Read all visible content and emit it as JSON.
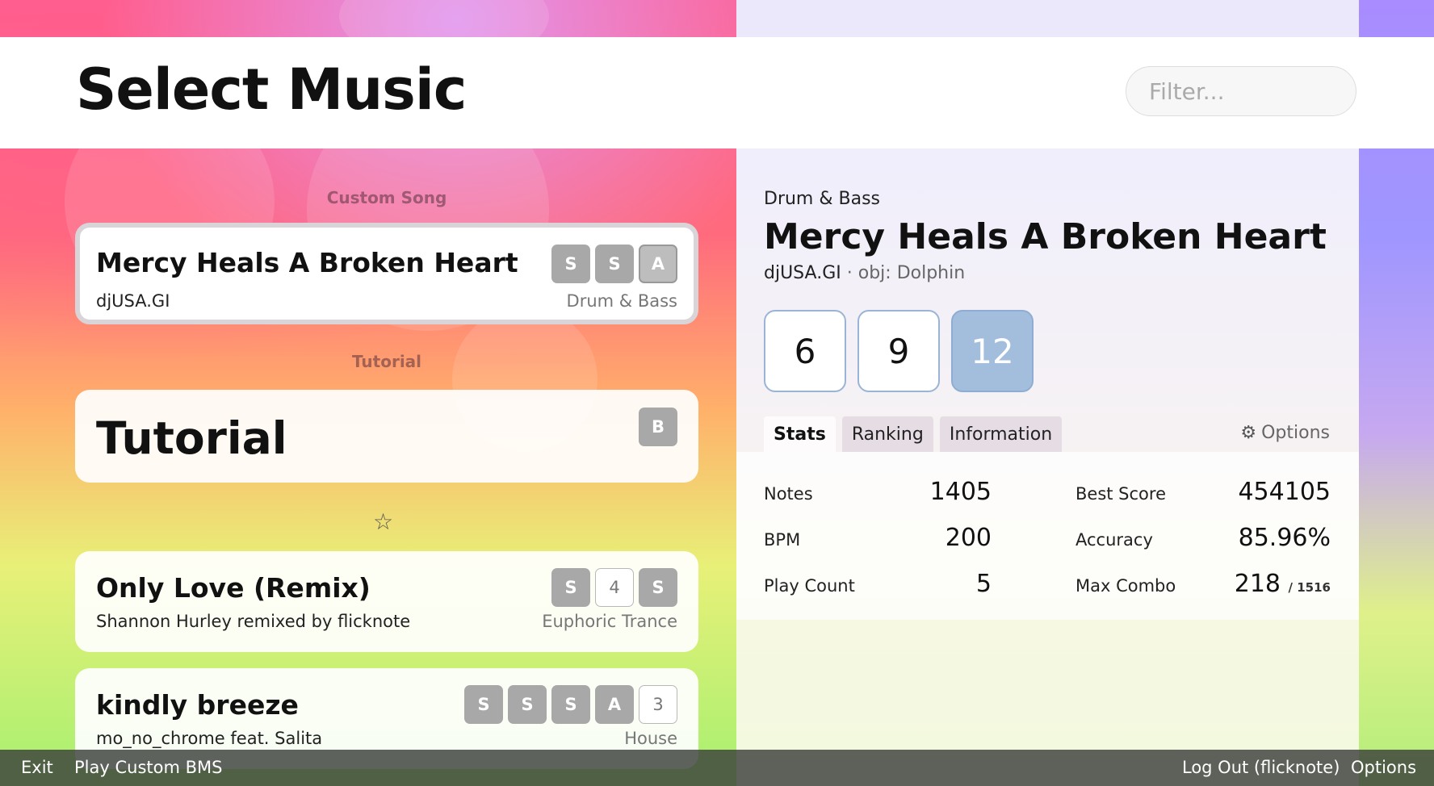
{
  "header": {
    "title": "Select Music",
    "filter_placeholder": "Filter..."
  },
  "song_list": {
    "sections": [
      {
        "label": "Custom Song",
        "songs": [
          {
            "title": "Mercy Heals A Broken Heart",
            "artist": "djUSA.GI",
            "genre": "Drum & Bass",
            "grades": [
              "S",
              "S",
              "A"
            ],
            "selected": true
          }
        ]
      },
      {
        "label": "Tutorial",
        "songs": [
          {
            "title": "Tutorial",
            "grades": [
              "B"
            ]
          }
        ]
      },
      {
        "label": "☆",
        "songs": [
          {
            "title": "Only Love (Remix)",
            "artist": "Shannon Hurley remixed by flicknote",
            "genre": "Euphoric Trance",
            "grades": [
              "S",
              "4",
              "S"
            ]
          },
          {
            "title": "kindly breeze",
            "artist": "mo_no_chrome feat. Salita",
            "genre": "House",
            "grades": [
              "S",
              "S",
              "S",
              "A",
              "3"
            ]
          }
        ]
      }
    ]
  },
  "detail": {
    "genre": "Drum & Bass",
    "title": "Mercy Heals A Broken Heart",
    "artist": "djUSA.GI",
    "separator": "·",
    "obj": "obj: Dolphin",
    "levels": [
      "6",
      "9",
      "12"
    ],
    "active_level": "12",
    "tabs": [
      "Stats",
      "Ranking",
      "Information"
    ],
    "active_tab": "Stats",
    "options_label": "Options",
    "stats": {
      "notes_label": "Notes",
      "notes_value": "1405",
      "bpm_label": "BPM",
      "bpm_value": "200",
      "play_count_label": "Play Count",
      "play_count_value": "5",
      "best_score_label": "Best Score",
      "best_score_value": "454105",
      "accuracy_label": "Accuracy",
      "accuracy_value": "85.96%",
      "max_combo_label": "Max Combo",
      "max_combo_value": "218",
      "max_combo_total": "/ 1516"
    }
  },
  "footer": {
    "exit": "Exit",
    "play_custom": "Play Custom BMS",
    "logout": "Log Out (flicknote)",
    "options": "Options"
  },
  "icons": {
    "options": "gear-icon",
    "favorites": "star-icon"
  },
  "colors": {
    "active_level": "#a3bedd",
    "grade_badge": "#a8a8a8"
  }
}
